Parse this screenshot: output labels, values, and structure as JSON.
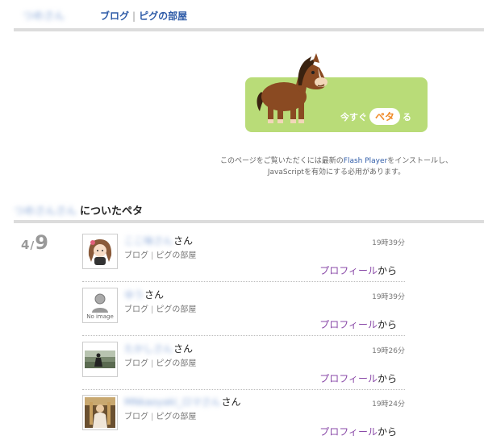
{
  "header": {
    "user_name": "つめさん",
    "nav_blog": "ブログ",
    "nav_sep": "|",
    "nav_room": "ピグの部屋"
  },
  "banner": {
    "cta_prefix": "今すぐ",
    "cta_pill": "ペタ",
    "cta_suffix": "る",
    "colors": {
      "bg": "#b9dc78",
      "pill_text": "#f08a28",
      "horse": "#8a4a22"
    }
  },
  "flash_note": {
    "before": "このページをご覧いただくには最新の",
    "flash_player": "Flash Player",
    "after": "をインストールし、",
    "line2": "JavaScriptを有効にする必用があります。"
  },
  "section": {
    "owner_name": "つめさんさん",
    "title": "についたペタ"
  },
  "date": {
    "month": "4",
    "slash": "/",
    "day": "9"
  },
  "entries": [
    {
      "name": "ここ味さん",
      "san": "さん",
      "blog": "ブログ",
      "sep": "|",
      "room": "ピグの部屋",
      "time": "19時39分",
      "profile": "プロフィール",
      "from": "から",
      "avatar": "girl-avatar"
    },
    {
      "name": "ゆう",
      "san": "さん",
      "blog": "ブログ",
      "sep": "|",
      "room": "ピグの部屋",
      "time": "19時39分",
      "profile": "プロフィール",
      "from": "から",
      "avatar": "no-image-avatar",
      "no_image": "No image"
    },
    {
      "name": "たかしさん",
      "san": "さん",
      "blog": "ブログ",
      "sep": "|",
      "room": "ピグの部屋",
      "time": "19時26分",
      "profile": "プロフィール",
      "from": "から",
      "avatar": "photo-avatar"
    },
    {
      "name": "MNkaoyaki_ロマさん",
      "san": "さん",
      "blog": "ブログ",
      "sep": "|",
      "room": "ピグの部屋",
      "time": "19時24分",
      "profile": "プロフィール",
      "from": "から",
      "avatar": "photo-avatar"
    }
  ]
}
